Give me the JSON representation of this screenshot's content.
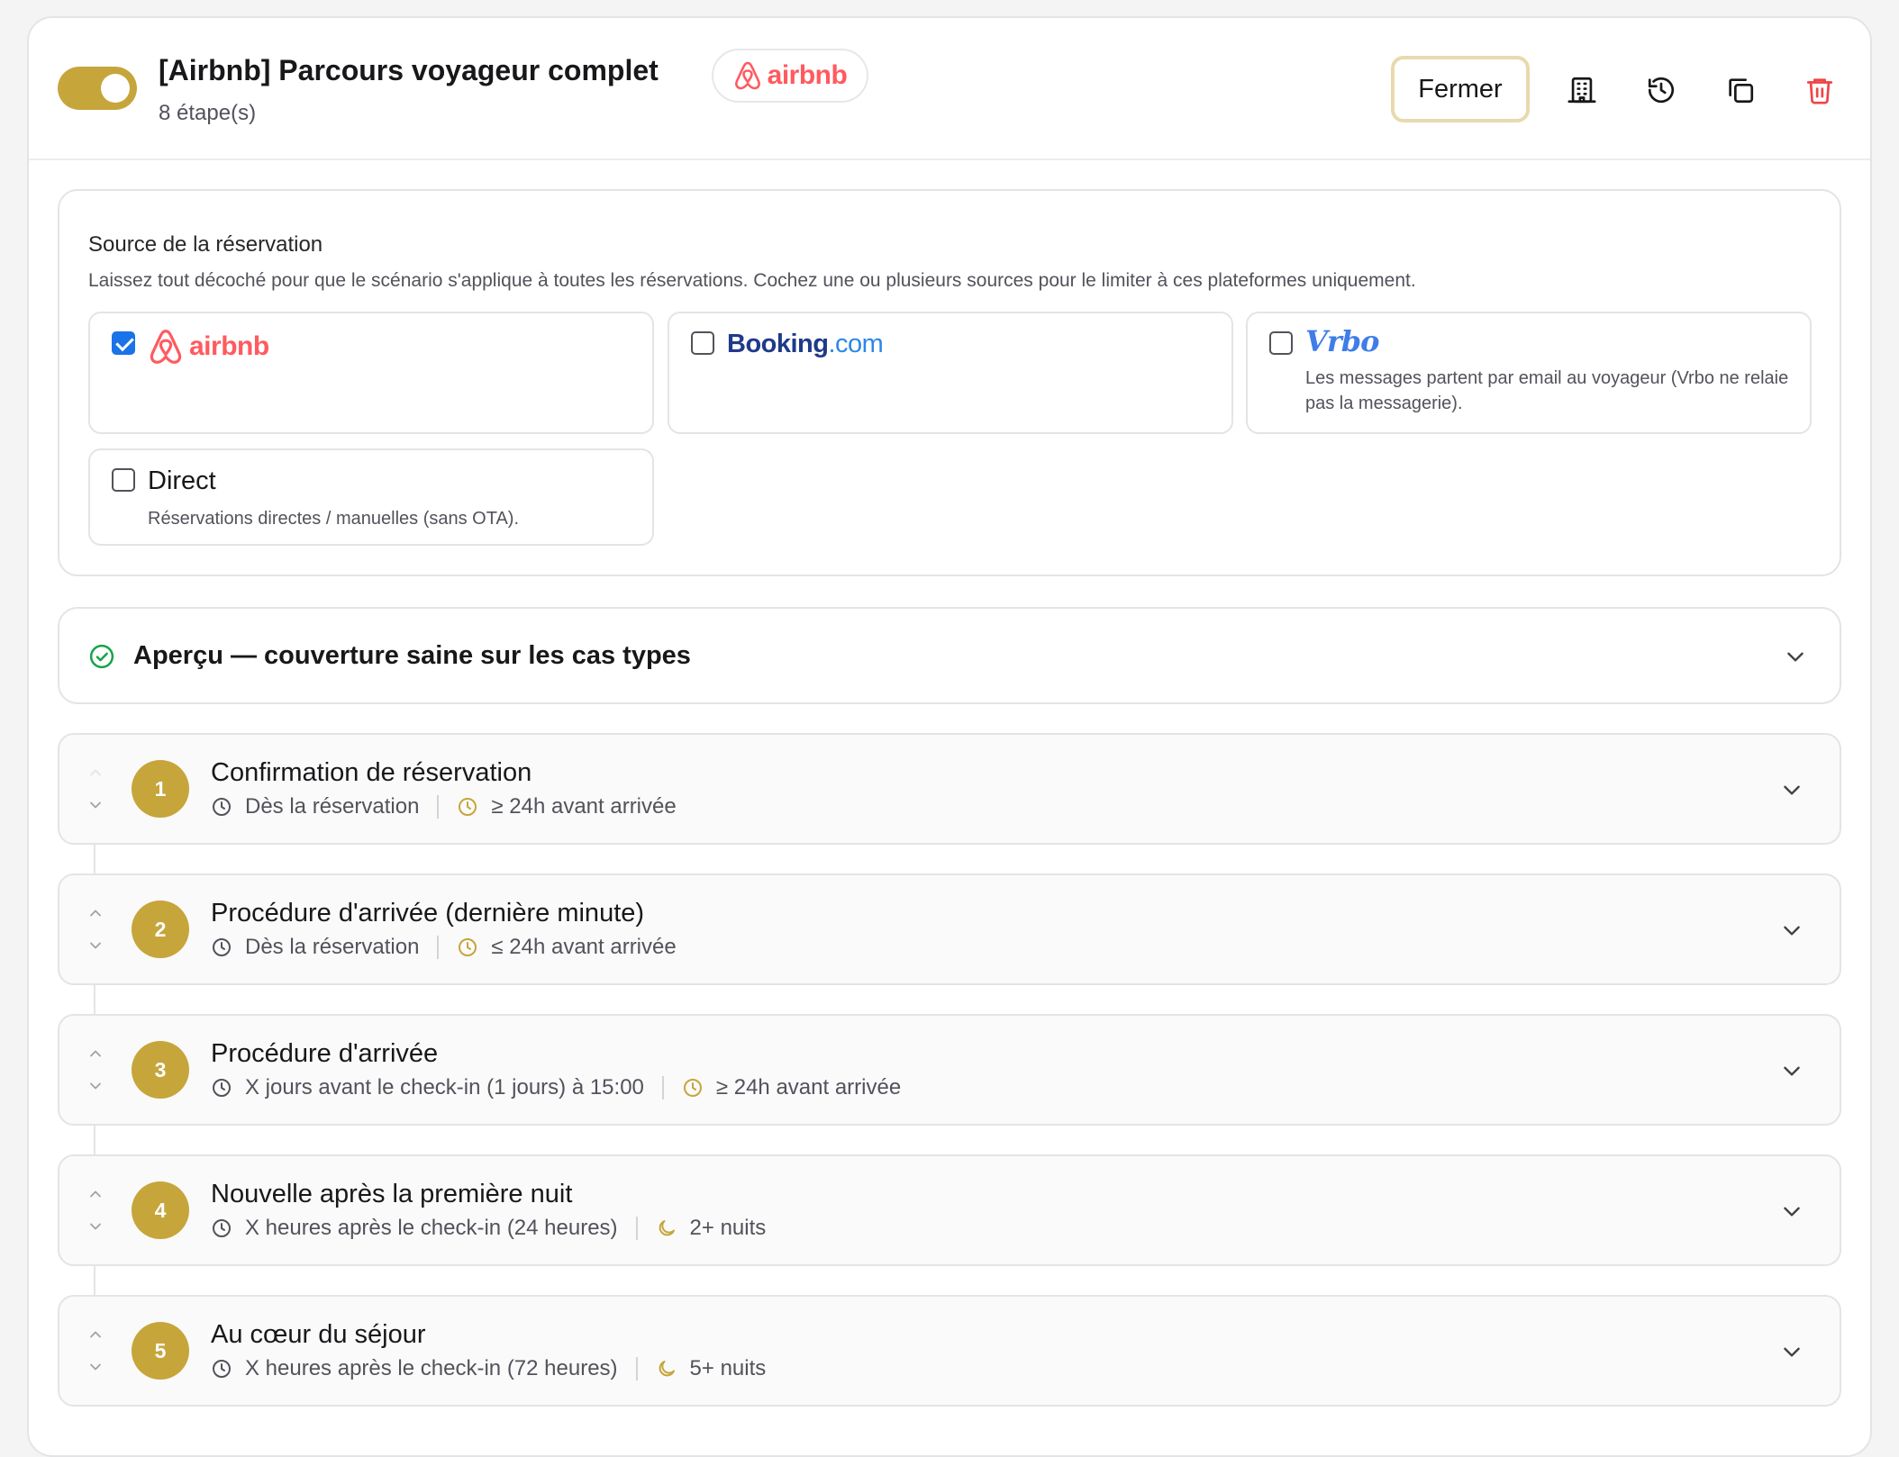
{
  "header": {
    "title": "[Airbnb] Parcours voyageur complet",
    "subtitle": "8 étape(s)",
    "badge": "airbnb",
    "close_label": "Fermer"
  },
  "source": {
    "title": "Source de la réservation",
    "help": "Laissez tout décoché pour que le scénario s'applique à toutes les réservations. Cochez une ou plusieurs sources pour le limiter à ces plateformes uniquement.",
    "options": [
      {
        "logo": "airbnb",
        "checked": true,
        "desc": ""
      },
      {
        "logo_main": "Booking",
        "logo_suffix": ".com",
        "checked": false,
        "desc": ""
      },
      {
        "logo": "Vrbo",
        "checked": false,
        "desc": "Les messages partent par email au voyageur (Vrbo ne relaie pas la messagerie)."
      },
      {
        "label": "Direct",
        "checked": false,
        "desc": "Réservations directes / manuelles (sans OTA)."
      }
    ]
  },
  "preview": {
    "title": "Aperçu — couverture saine sur les cas types"
  },
  "steps": [
    {
      "number": "1",
      "title": "Confirmation de réservation",
      "trigger": "Dès la réservation",
      "condition": "≥ 24h avant arrivée",
      "condition_icon": "clock-icon"
    },
    {
      "number": "2",
      "title": "Procédure d'arrivée (dernière minute)",
      "trigger": "Dès la réservation",
      "condition": "≤ 24h avant arrivée",
      "condition_icon": "clock-icon"
    },
    {
      "number": "3",
      "title": "Procédure d'arrivée",
      "trigger": "X jours avant le check-in (1 jours) à 15:00",
      "condition": "≥ 24h avant arrivée",
      "condition_icon": "clock-icon"
    },
    {
      "number": "4",
      "title": "Nouvelle après la première nuit",
      "trigger": "X heures après le check-in (24 heures)",
      "condition": "2+ nuits",
      "condition_icon": "moon-icon"
    },
    {
      "number": "5",
      "title": "Au cœur du séjour",
      "trigger": "X heures après le check-in (72 heures)",
      "condition": "5+ nuits",
      "condition_icon": "moon-icon"
    }
  ],
  "colors": {
    "accent": "#c6a53b",
    "airbnb": "#ff5a5f",
    "danger": "#ef4444",
    "success": "#16a34a",
    "checkbox": "#1a73e8"
  }
}
